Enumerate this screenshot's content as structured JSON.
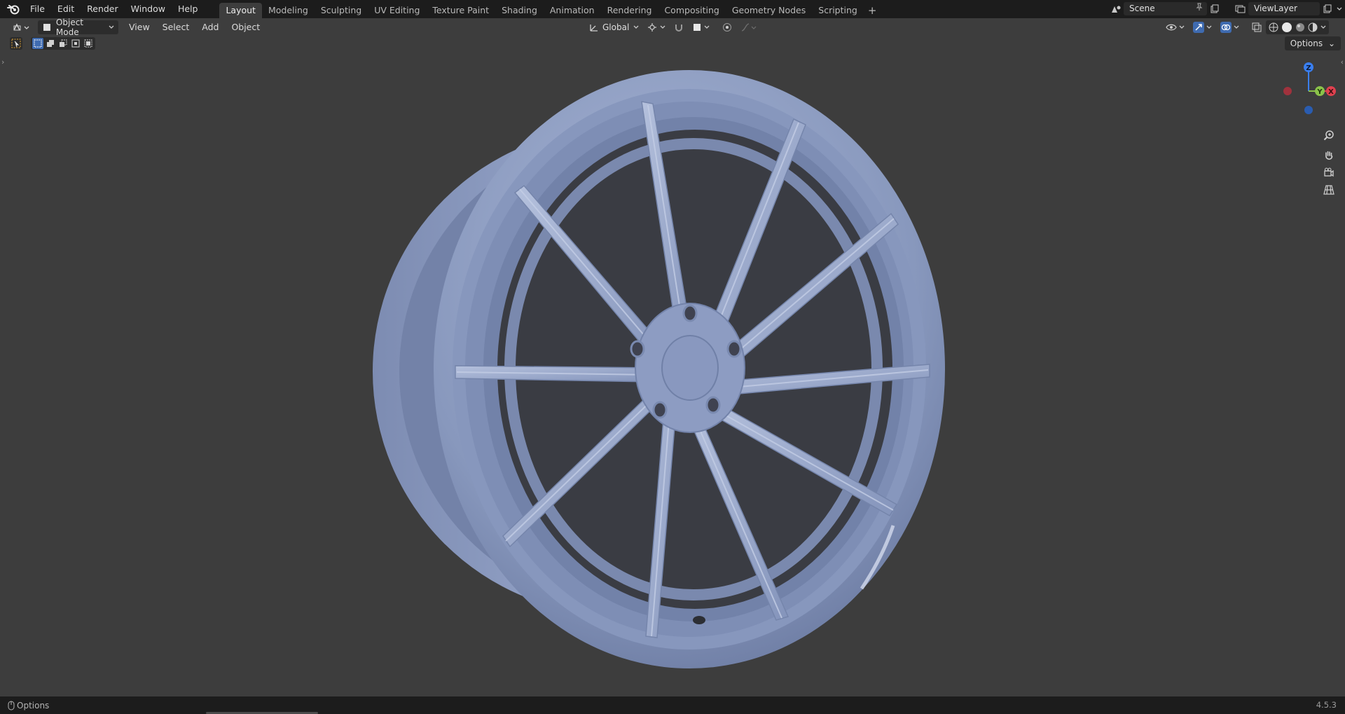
{
  "topbar": {
    "menu": [
      "File",
      "Edit",
      "Render",
      "Window",
      "Help"
    ],
    "workspaces": [
      "Layout",
      "Modeling",
      "Sculpting",
      "UV Editing",
      "Texture Paint",
      "Shading",
      "Animation",
      "Rendering",
      "Compositing",
      "Geometry Nodes",
      "Scripting"
    ],
    "active_workspace": "Layout",
    "add_workspace": "+",
    "scene": "Scene",
    "view_layer": "ViewLayer"
  },
  "header": {
    "mode": "Object Mode",
    "menus": [
      "View",
      "Select",
      "Add",
      "Object"
    ],
    "transform_orientation": "Global",
    "options_label": "Options"
  },
  "gizmo": {
    "axes": {
      "x": "X",
      "y": "Y",
      "z": "Z"
    },
    "colors": {
      "x": "#e0414f",
      "y": "#8bc34a",
      "z": "#3a7ff0"
    }
  },
  "colors": {
    "viewport_bg": "#3d3d3d",
    "topbar_bg": "#1c1c1c",
    "wheel": "#8f9fc2"
  },
  "statusbar": {
    "left_label": "Options",
    "version": "4.5.3"
  }
}
